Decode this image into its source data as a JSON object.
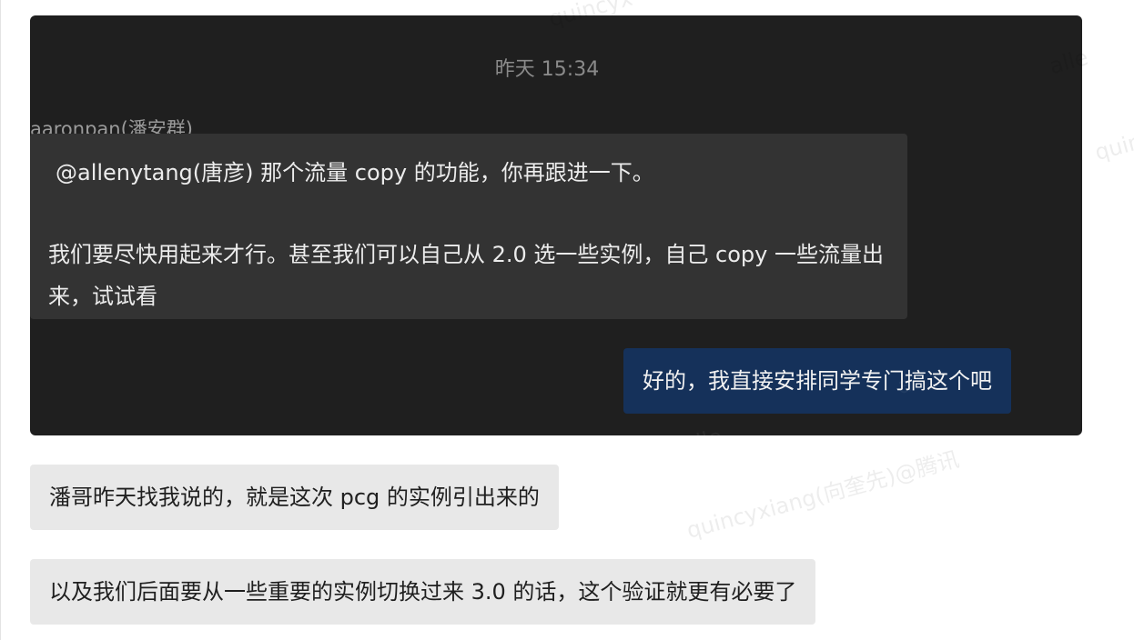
{
  "chat": {
    "quoted": {
      "timestamp": "昨天 15:34",
      "sender": "aaronpan(潘安群)",
      "message_line1": "@allenytang(唐彦) 那个流量 copy 的功能，你再跟进一下。",
      "message_line2": "我们要尽快用起来才行。甚至我们可以自己从 2.0 选一些实例，自己 copy 一些流量出来，试试看",
      "reply": "好的，我直接安排同学专门搞这个吧"
    },
    "messages": [
      {
        "text": "潘哥昨天找我说的，就是这次 pcg 的实例引出来的"
      },
      {
        "text": "以及我们后面要从一些重要的实例切换过来 3.0 的话，这个验证就更有必要了"
      }
    ],
    "watermark": {
      "full": "quincyxiang(向奎先)@腾讯",
      "top": "quincyx",
      "right_upper": "alle",
      "right_lower": "quin",
      "inner_low": "alle",
      "inner_mid": "a"
    }
  },
  "colors": {
    "panel_bg": "#1f1f1f",
    "dark_bubble": "#333333",
    "reply_bubble": "#15315a",
    "light_bubble": "#e8e8e8"
  }
}
